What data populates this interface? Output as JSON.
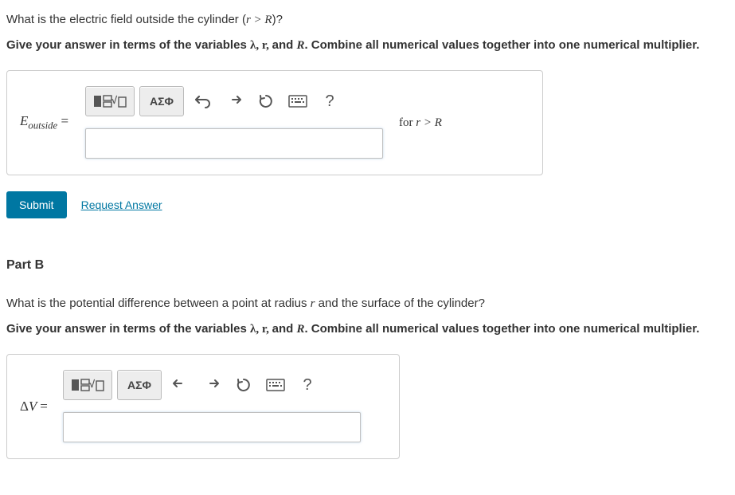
{
  "partA": {
    "question_pre": "What is the electric field outside the cylinder (",
    "question_cond": "r > R",
    "question_post": ")?",
    "instruction_pre": "Give your answer in terms of the variables ",
    "vars": "λ, r, ",
    "vars_and": "and ",
    "vars_last": "R",
    "instruction_post": ". Combine all numerical values together into one numerical multiplier.",
    "prefix_E": "E",
    "prefix_sub": "outside",
    "equals": " =",
    "suffix_pre": "for ",
    "suffix_cond": "r > R",
    "toolbar": {
      "templates": "x frac root",
      "greek": "ΑΣΦ",
      "help": "?"
    },
    "input_value": "",
    "submit": "Submit",
    "request": "Request Answer"
  },
  "partB": {
    "header": "Part B",
    "question": "What is the potential difference between a point at radius r and the surface of the cylinder?",
    "instruction_pre": "Give your answer in terms of the variables ",
    "vars": "λ, r, ",
    "vars_and": "and ",
    "vars_last": "R",
    "instruction_post": ". Combine all numerical values together into one numerical multiplier.",
    "prefix": "ΔV =",
    "toolbar": {
      "greek": "ΑΣΦ",
      "help": "?"
    },
    "input_value": ""
  }
}
